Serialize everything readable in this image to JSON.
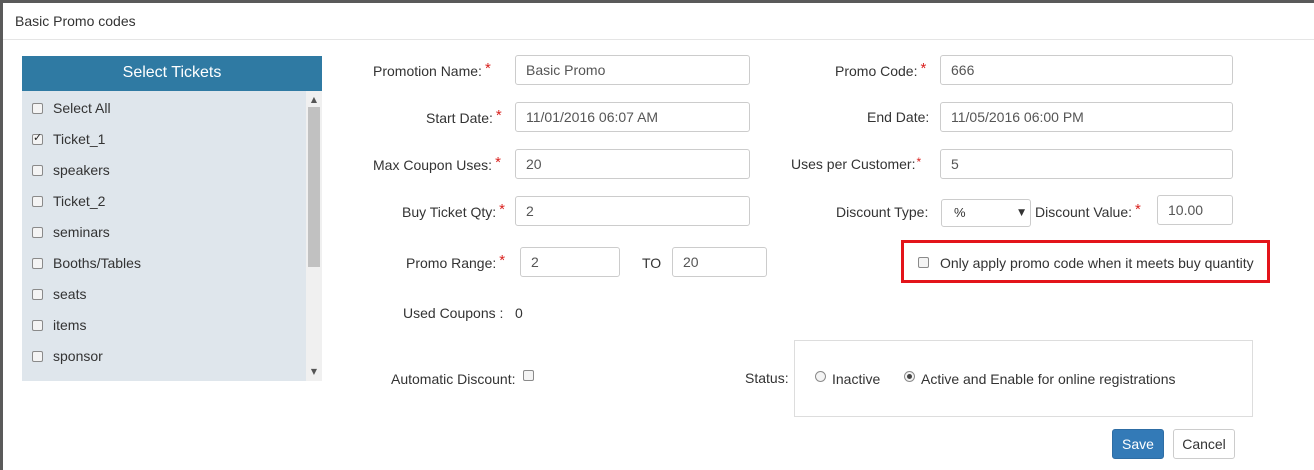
{
  "modal": {
    "title": "Basic Promo codes"
  },
  "tickets": {
    "header": "Select Tickets",
    "items": [
      {
        "label": "Select All",
        "checked": false
      },
      {
        "label": "Ticket_1",
        "checked": true
      },
      {
        "label": "speakers",
        "checked": false
      },
      {
        "label": "Ticket_2",
        "checked": false
      },
      {
        "label": "seminars",
        "checked": false
      },
      {
        "label": "Booths/Tables",
        "checked": false
      },
      {
        "label": "seats",
        "checked": false
      },
      {
        "label": "items",
        "checked": false
      },
      {
        "label": "sponsor",
        "checked": false
      }
    ]
  },
  "form": {
    "promotion_name": {
      "label": "Promotion Name:",
      "value": "Basic Promo"
    },
    "promo_code": {
      "label": "Promo Code:",
      "value": "666"
    },
    "start_date": {
      "label": "Start Date:",
      "value": "11/01/2016 06:07 AM"
    },
    "end_date": {
      "label": "End Date:",
      "value": "11/05/2016 06:00 PM"
    },
    "max_coupon_uses": {
      "label": "Max Coupon Uses:",
      "value": "20"
    },
    "uses_per_customer": {
      "label": "Uses per Customer:",
      "value": "5"
    },
    "buy_ticket_qty": {
      "label": "Buy Ticket Qty:",
      "value": "2"
    },
    "discount_type": {
      "label": "Discount Type:",
      "value": "%"
    },
    "discount_value": {
      "label": "Discount Value:",
      "value": "10.00"
    },
    "promo_range": {
      "label": "Promo Range:",
      "from": "2",
      "to_label": "TO",
      "to": "20"
    },
    "buy_quantity_option": {
      "label": "Only apply promo code when it meets buy quantity",
      "checked": false
    },
    "used_coupons": {
      "label": "Used Coupons :",
      "value": "0"
    },
    "automatic_discount": {
      "label": "Automatic Discount:",
      "checked": false
    },
    "status": {
      "label": "Status:",
      "options": [
        {
          "label": "Inactive",
          "selected": false
        },
        {
          "label": "Active and Enable for online registrations",
          "selected": true
        }
      ]
    }
  },
  "buttons": {
    "save": "Save",
    "cancel": "Cancel"
  },
  "colors": {
    "header": "#2f7aa3",
    "save": "#337ab7",
    "highlight": "#e3141a",
    "required": "#d9211e"
  }
}
